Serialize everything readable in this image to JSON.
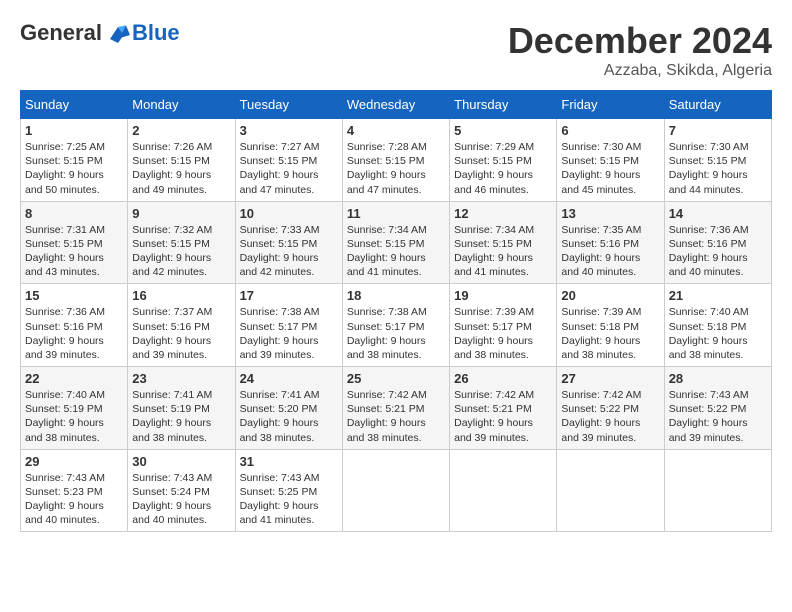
{
  "logo": {
    "general": "General",
    "blue": "Blue"
  },
  "title": {
    "month_year": "December 2024",
    "location": "Azzaba, Skikda, Algeria"
  },
  "calendar": {
    "headers": [
      "Sunday",
      "Monday",
      "Tuesday",
      "Wednesday",
      "Thursday",
      "Friday",
      "Saturday"
    ],
    "weeks": [
      [
        {
          "day": "1",
          "info": "Sunrise: 7:25 AM\nSunset: 5:15 PM\nDaylight: 9 hours\nand 50 minutes."
        },
        {
          "day": "2",
          "info": "Sunrise: 7:26 AM\nSunset: 5:15 PM\nDaylight: 9 hours\nand 49 minutes."
        },
        {
          "day": "3",
          "info": "Sunrise: 7:27 AM\nSunset: 5:15 PM\nDaylight: 9 hours\nand 47 minutes."
        },
        {
          "day": "4",
          "info": "Sunrise: 7:28 AM\nSunset: 5:15 PM\nDaylight: 9 hours\nand 47 minutes."
        },
        {
          "day": "5",
          "info": "Sunrise: 7:29 AM\nSunset: 5:15 PM\nDaylight: 9 hours\nand 46 minutes."
        },
        {
          "day": "6",
          "info": "Sunrise: 7:30 AM\nSunset: 5:15 PM\nDaylight: 9 hours\nand 45 minutes."
        },
        {
          "day": "7",
          "info": "Sunrise: 7:30 AM\nSunset: 5:15 PM\nDaylight: 9 hours\nand 44 minutes."
        }
      ],
      [
        {
          "day": "8",
          "info": "Sunrise: 7:31 AM\nSunset: 5:15 PM\nDaylight: 9 hours\nand 43 minutes."
        },
        {
          "day": "9",
          "info": "Sunrise: 7:32 AM\nSunset: 5:15 PM\nDaylight: 9 hours\nand 42 minutes."
        },
        {
          "day": "10",
          "info": "Sunrise: 7:33 AM\nSunset: 5:15 PM\nDaylight: 9 hours\nand 42 minutes."
        },
        {
          "day": "11",
          "info": "Sunrise: 7:34 AM\nSunset: 5:15 PM\nDaylight: 9 hours\nand 41 minutes."
        },
        {
          "day": "12",
          "info": "Sunrise: 7:34 AM\nSunset: 5:15 PM\nDaylight: 9 hours\nand 41 minutes."
        },
        {
          "day": "13",
          "info": "Sunrise: 7:35 AM\nSunset: 5:16 PM\nDaylight: 9 hours\nand 40 minutes."
        },
        {
          "day": "14",
          "info": "Sunrise: 7:36 AM\nSunset: 5:16 PM\nDaylight: 9 hours\nand 40 minutes."
        }
      ],
      [
        {
          "day": "15",
          "info": "Sunrise: 7:36 AM\nSunset: 5:16 PM\nDaylight: 9 hours\nand 39 minutes."
        },
        {
          "day": "16",
          "info": "Sunrise: 7:37 AM\nSunset: 5:16 PM\nDaylight: 9 hours\nand 39 minutes."
        },
        {
          "day": "17",
          "info": "Sunrise: 7:38 AM\nSunset: 5:17 PM\nDaylight: 9 hours\nand 39 minutes."
        },
        {
          "day": "18",
          "info": "Sunrise: 7:38 AM\nSunset: 5:17 PM\nDaylight: 9 hours\nand 38 minutes."
        },
        {
          "day": "19",
          "info": "Sunrise: 7:39 AM\nSunset: 5:17 PM\nDaylight: 9 hours\nand 38 minutes."
        },
        {
          "day": "20",
          "info": "Sunrise: 7:39 AM\nSunset: 5:18 PM\nDaylight: 9 hours\nand 38 minutes."
        },
        {
          "day": "21",
          "info": "Sunrise: 7:40 AM\nSunset: 5:18 PM\nDaylight: 9 hours\nand 38 minutes."
        }
      ],
      [
        {
          "day": "22",
          "info": "Sunrise: 7:40 AM\nSunset: 5:19 PM\nDaylight: 9 hours\nand 38 minutes."
        },
        {
          "day": "23",
          "info": "Sunrise: 7:41 AM\nSunset: 5:19 PM\nDaylight: 9 hours\nand 38 minutes."
        },
        {
          "day": "24",
          "info": "Sunrise: 7:41 AM\nSunset: 5:20 PM\nDaylight: 9 hours\nand 38 minutes."
        },
        {
          "day": "25",
          "info": "Sunrise: 7:42 AM\nSunset: 5:21 PM\nDaylight: 9 hours\nand 38 minutes."
        },
        {
          "day": "26",
          "info": "Sunrise: 7:42 AM\nSunset: 5:21 PM\nDaylight: 9 hours\nand 39 minutes."
        },
        {
          "day": "27",
          "info": "Sunrise: 7:42 AM\nSunset: 5:22 PM\nDaylight: 9 hours\nand 39 minutes."
        },
        {
          "day": "28",
          "info": "Sunrise: 7:43 AM\nSunset: 5:22 PM\nDaylight: 9 hours\nand 39 minutes."
        }
      ],
      [
        {
          "day": "29",
          "info": "Sunrise: 7:43 AM\nSunset: 5:23 PM\nDaylight: 9 hours\nand 40 minutes."
        },
        {
          "day": "30",
          "info": "Sunrise: 7:43 AM\nSunset: 5:24 PM\nDaylight: 9 hours\nand 40 minutes."
        },
        {
          "day": "31",
          "info": "Sunrise: 7:43 AM\nSunset: 5:25 PM\nDaylight: 9 hours\nand 41 minutes."
        },
        {
          "day": "",
          "info": ""
        },
        {
          "day": "",
          "info": ""
        },
        {
          "day": "",
          "info": ""
        },
        {
          "day": "",
          "info": ""
        }
      ]
    ]
  }
}
